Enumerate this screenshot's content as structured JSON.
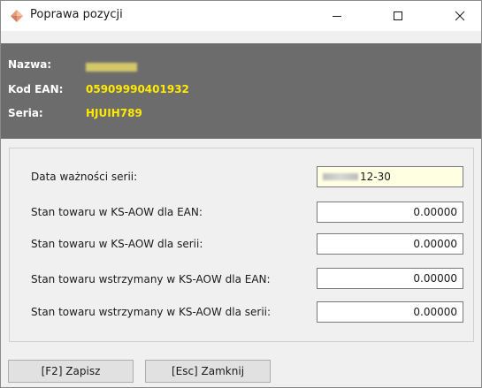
{
  "window": {
    "title": "Poprawa pozycji",
    "icon": "diamond-app-icon",
    "controls": {
      "minimize": "minimize-icon",
      "maximize": "maximize-icon",
      "close": "close-icon"
    }
  },
  "info": {
    "name_label": "Nazwa:",
    "ean_label": "Kod EAN:",
    "ean_value": "05909990401932",
    "series_label": "Seria:",
    "series_value": "HJUIH789"
  },
  "form": {
    "fields": [
      {
        "label": "Data ważności serii:",
        "value": "12-30"
      },
      {
        "label": "Stan towaru w KS-AOW dla EAN:",
        "value": "0.00000"
      },
      {
        "label": "Stan towaru w KS-AOW dla serii:",
        "value": "0.00000"
      },
      {
        "label": "Stan towaru wstrzymany w KS-AOW dla EAN:",
        "value": "0.00000"
      },
      {
        "label": "Stan towaru wstrzymany w KS-AOW dla serii:",
        "value": "0.00000"
      }
    ]
  },
  "buttons": {
    "save": "[F2] Zapisz",
    "close": "[Esc] Zamknij"
  },
  "colors": {
    "header_bg": "#6c6c6c",
    "label_color": "#ffffff",
    "value_color": "#ffea00",
    "date_field_bg": "#ffffe1"
  }
}
